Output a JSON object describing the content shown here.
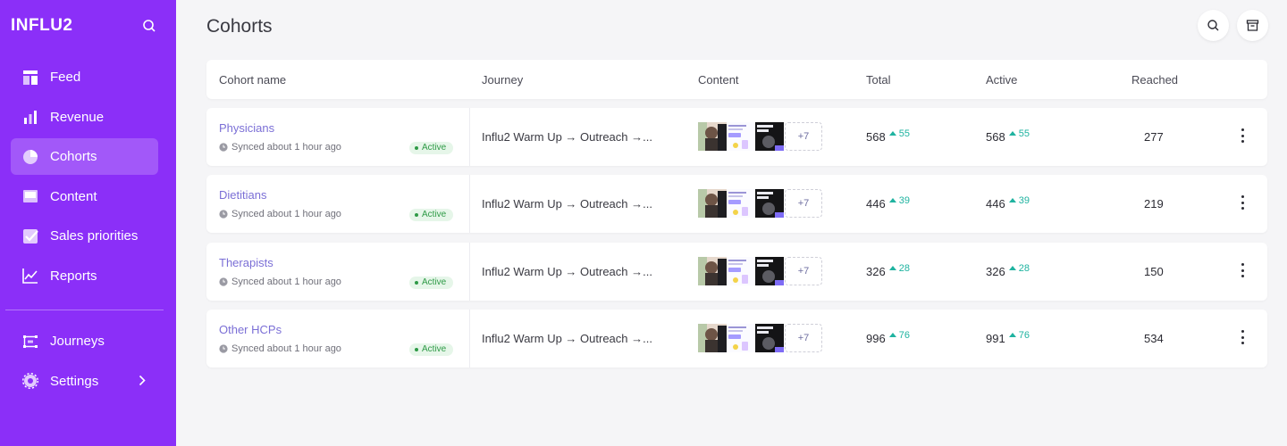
{
  "brand": "INFLU2",
  "page_title": "Cohorts",
  "nav": [
    {
      "label": "Feed",
      "icon": "feed-icon"
    },
    {
      "label": "Revenue",
      "icon": "bar-chart-icon"
    },
    {
      "label": "Cohorts",
      "icon": "pie-chart-icon",
      "active": true
    },
    {
      "label": "Content",
      "icon": "content-icon"
    },
    {
      "label": "Sales priorities",
      "icon": "checkbox-icon"
    },
    {
      "label": "Reports",
      "icon": "line-chart-icon"
    }
  ],
  "nav_bottom": [
    {
      "label": "Journeys",
      "icon": "journeys-icon"
    },
    {
      "label": "Settings",
      "icon": "settings-icon"
    }
  ],
  "table": {
    "headers": [
      "Cohort name",
      "Journey",
      "Content",
      "Total",
      "Active",
      "Reached"
    ],
    "rows": [
      {
        "name": "Physicians",
        "synced": "Synced about 1 hour ago",
        "status": "Active",
        "journey": "Influ2 Warm Up → Outreach →...",
        "more": "+7",
        "total": "568",
        "total_delta": "55",
        "active": "568",
        "active_delta": "55",
        "reached": "277"
      },
      {
        "name": "Dietitians",
        "synced": "Synced about 1 hour ago",
        "status": "Active",
        "journey": "Influ2 Warm Up → Outreach →...",
        "more": "+7",
        "total": "446",
        "total_delta": "39",
        "active": "446",
        "active_delta": "39",
        "reached": "219"
      },
      {
        "name": "Therapists",
        "synced": "Synced about 1 hour ago",
        "status": "Active",
        "journey": "Influ2 Warm Up → Outreach →...",
        "more": "+7",
        "total": "326",
        "total_delta": "28",
        "active": "326",
        "active_delta": "28",
        "reached": "150"
      },
      {
        "name": "Other HCPs",
        "synced": "Synced about 1 hour ago",
        "status": "Active",
        "journey": "Influ2 Warm Up → Outreach →...",
        "more": "+7",
        "total": "996",
        "total_delta": "76",
        "active": "991",
        "active_delta": "76",
        "reached": "534"
      }
    ]
  },
  "colors": {
    "sidebar": "#8b2ff8",
    "accent_link": "#7b6fd6",
    "delta": "#1fb3a0",
    "active_badge": "#2e9a46"
  }
}
